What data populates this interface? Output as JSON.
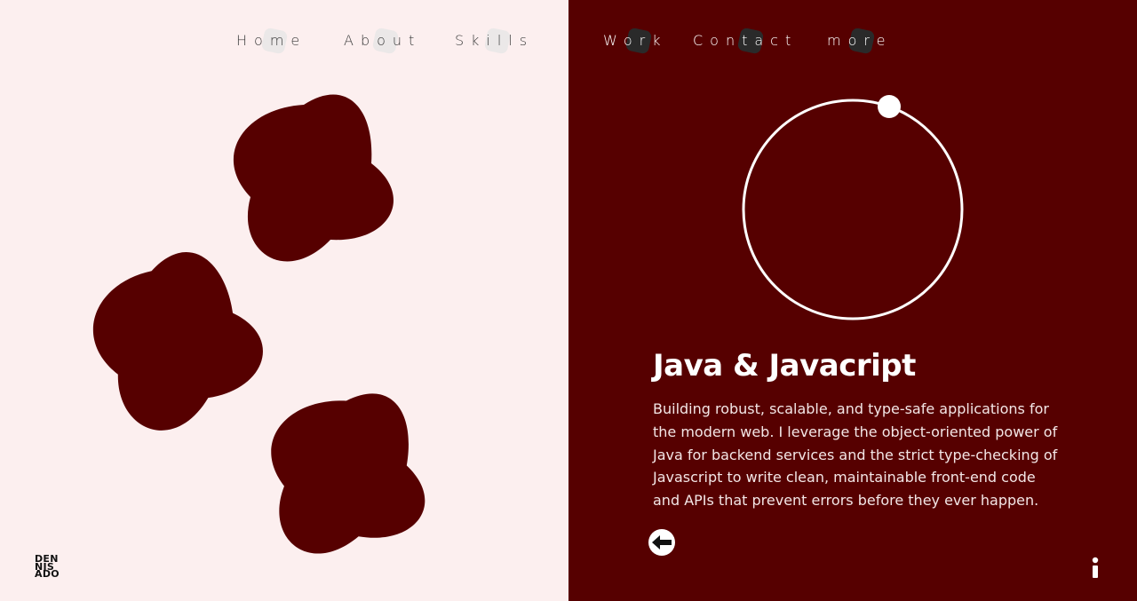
{
  "nav": {
    "home": "Home",
    "about": "About",
    "skills": "Skills",
    "work": "Work",
    "contact": "Contact",
    "more": "more"
  },
  "skill": {
    "title": "Java & Javacript",
    "description": "Building robust, scalable, and type-safe applications for the modern web. I leverage the object-oriented power of Java for backend services and the strict type-checking of Javascript to write clean, maintainable front-end code and APIs that prevent errors before they ever happen."
  },
  "logo": {
    "line1": "DEN",
    "line2": "NIS",
    "line3": "ADO"
  },
  "icons": {
    "back": "arrow-left-icon",
    "info": "info-icon",
    "shape": "quatrefoil-blob"
  },
  "colors": {
    "left_background": "#fcefef",
    "right_background": "#560000",
    "shape_fill": "#560000",
    "text_light": "#ffffff",
    "text_dark": "#3a3a3a"
  }
}
